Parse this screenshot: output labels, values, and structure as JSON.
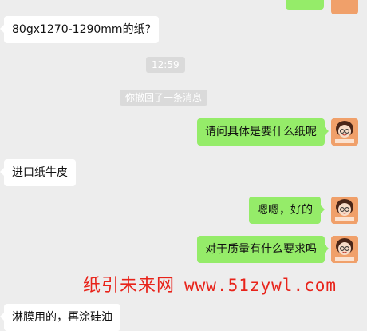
{
  "chat": {
    "messages": [
      {
        "side": "right",
        "text": ""
      },
      {
        "side": "left",
        "text": "80gx1270-1290mm的纸?"
      },
      {
        "side": "right",
        "text": "请问具体是要什么纸呢"
      },
      {
        "side": "left",
        "text": "进口纸牛皮"
      },
      {
        "side": "right",
        "text": "嗯嗯，好的"
      },
      {
        "side": "right",
        "text": "对于质量有什么要求吗"
      },
      {
        "side": "left",
        "text": "淋膜用的，再涂硅油"
      }
    ],
    "timestamp": "12:59",
    "recall_notice": "你撤回了一条消息",
    "avatar_caption": "纸引未来网"
  },
  "watermark": {
    "brand": "纸引未来网",
    "url": "www.51zywl.com"
  },
  "colors": {
    "background": "#ededed",
    "bubble_self": "#95ec69",
    "bubble_other": "#ffffff",
    "watermark": "#e8231a",
    "avatar_bg": "#f0a06a"
  }
}
